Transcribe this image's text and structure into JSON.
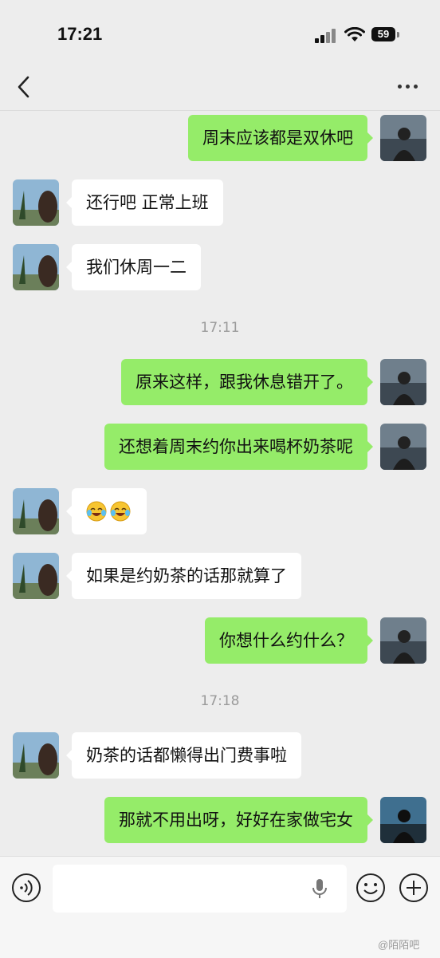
{
  "status_bar": {
    "time": "17:21",
    "battery": "59"
  },
  "nav": {
    "title": "",
    "back_icon": "chevron-left-icon",
    "more_icon": "more-dots-icon"
  },
  "messages": [
    {
      "id": "m1",
      "side": "out",
      "text": "周末应该都是双休吧"
    },
    {
      "id": "m2",
      "side": "in",
      "text": "还行吧 正常上班"
    },
    {
      "id": "m3",
      "side": "in",
      "text": "我们休周一二"
    },
    {
      "id": "t1",
      "type": "time",
      "text": "17:11"
    },
    {
      "id": "m4",
      "side": "out",
      "text": "原来这样，跟我休息错开了。"
    },
    {
      "id": "m5",
      "side": "out",
      "text": "还想着周末约你出来喝杯奶茶呢"
    },
    {
      "id": "m6",
      "side": "in",
      "text": "",
      "emojis": [
        "laughing-crying-emoji",
        "laughing-crying-emoji"
      ]
    },
    {
      "id": "m7",
      "side": "in",
      "text": "如果是约奶茶的话那就算了"
    },
    {
      "id": "m8",
      "side": "out",
      "text": "你想什么约什么？"
    },
    {
      "id": "t2",
      "type": "time",
      "text": "17:18"
    },
    {
      "id": "m9",
      "side": "in",
      "text": "奶茶的话都懒得出门费事啦"
    },
    {
      "id": "m10",
      "side": "out",
      "text": "那就不用出呀，好好在家做宅女"
    }
  ],
  "input_bar": {
    "placeholder": "",
    "voice_icon": "voice-icon",
    "mic_icon": "microphone-icon",
    "emoji_icon": "smiley-icon",
    "plus_icon": "plus-circle-icon"
  },
  "watermark": "@陌陌吧"
}
